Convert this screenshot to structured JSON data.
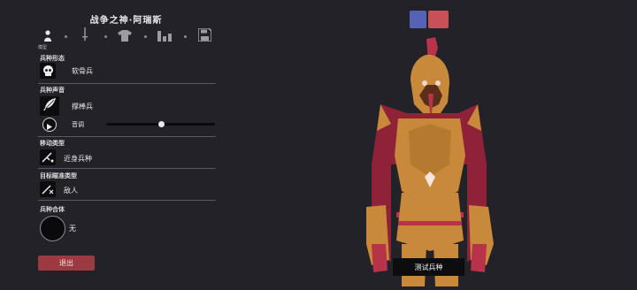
{
  "header": {
    "title": "战争之神·阿瑞斯"
  },
  "steps": [
    {
      "icon": "body-icon",
      "label": "模型"
    },
    {
      "icon": "sword-icon",
      "label": ""
    },
    {
      "icon": "shirt-icon",
      "label": ""
    },
    {
      "icon": "stats-icon",
      "label": ""
    },
    {
      "icon": "save-icon",
      "label": ""
    }
  ],
  "sections": {
    "form": {
      "label": "兵种形态",
      "value": "软骨兵"
    },
    "voice": {
      "label": "兵种声音",
      "value": "撑棒兵",
      "pitch_label": "音调",
      "pitch_level": 0.5
    },
    "movement": {
      "label": "移动类型",
      "value": "近身兵种"
    },
    "targeting": {
      "label": "目标瞄准类型",
      "value": "敌人"
    },
    "combine": {
      "label": "兵种合体",
      "value": "无"
    }
  },
  "buttons": {
    "exit": "退出",
    "test": "测试兵种"
  },
  "team_colors": [
    "#5463b8",
    "#c75157"
  ],
  "colors": {
    "exit_button": "#9b3a40",
    "armor_gold": "#c8893a",
    "armor_red": "#b8324a"
  }
}
